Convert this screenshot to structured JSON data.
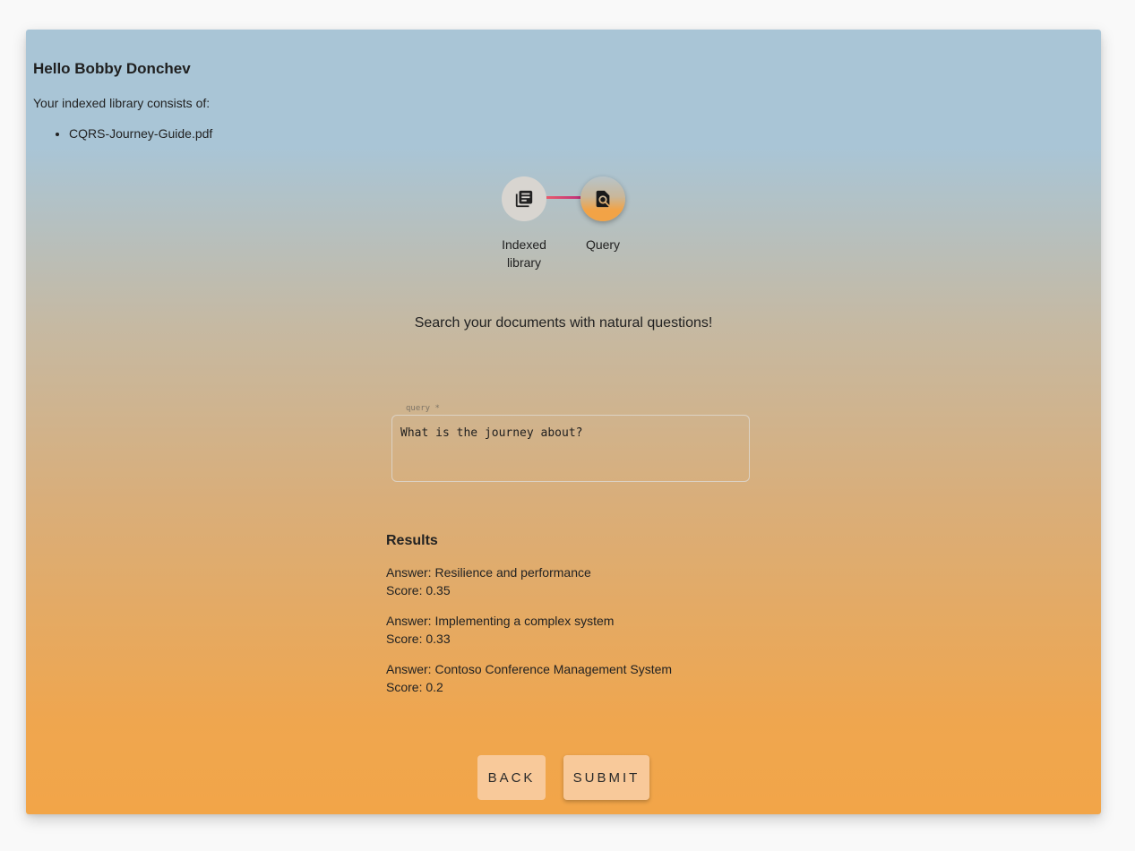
{
  "header": {
    "greeting": "Hello Bobby Donchev",
    "library_intro": "Your indexed library consists of:",
    "library_items": [
      "CQRS-Journey-Guide.pdf"
    ]
  },
  "stepper": {
    "steps": [
      {
        "label": "Indexed library",
        "icon": "library-books-icon",
        "active": false
      },
      {
        "label": "Query",
        "icon": "find-in-page-icon",
        "active": true
      }
    ],
    "connector_colors": [
      "#e85a6b",
      "#c0317a"
    ]
  },
  "main": {
    "tagline": "Search your documents with natural questions!"
  },
  "query_field": {
    "label": "query *",
    "value": "What is the journey about?"
  },
  "results": {
    "heading": "Results",
    "items": [
      {
        "answer": "Answer: Resilience and performance",
        "score": "Score: 0.35"
      },
      {
        "answer": "Answer: Implementing a complex system",
        "score": "Score: 0.33"
      },
      {
        "answer": "Answer: Contoso Conference Management System",
        "score": "Score: 0.2"
      }
    ]
  },
  "actions": {
    "back_label": "BACK",
    "submit_label": "SUBMIT"
  },
  "colors": {
    "gradient_top": "#a9c5d6",
    "gradient_bottom": "#f2a548",
    "button_bg": "#f8c99a"
  }
}
